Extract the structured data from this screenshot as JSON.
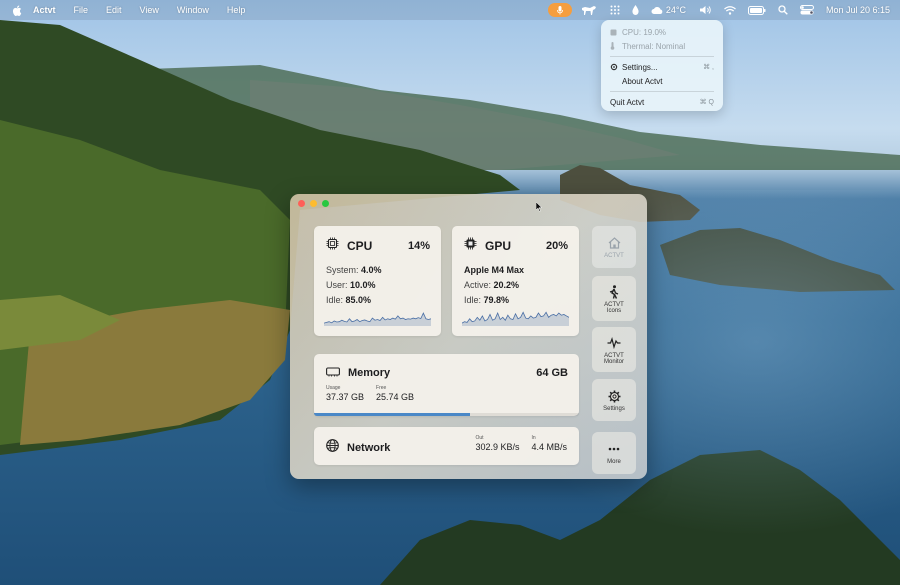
{
  "menubar": {
    "app_name": "Actvt",
    "menus": [
      "File",
      "Edit",
      "View",
      "Window",
      "Help"
    ],
    "weather": "24°C",
    "clock": "Mon Jul 20  6:15",
    "icons": [
      "apple-icon",
      "microphone-icon",
      "horse-icon",
      "grid-icon",
      "drop-icon",
      "cloud-icon",
      "volume-icon",
      "wifi-icon",
      "battery-icon",
      "search-icon",
      "control-center-icon"
    ]
  },
  "dropdown": {
    "cpu": "CPU: 19.0%",
    "thermal": "Thermal: Nominal",
    "settings": "Settings...",
    "settings_shortcut": "⌘ ,",
    "about": "About Actvt",
    "quit": "Quit Actvt",
    "quit_shortcut": "⌘ Q"
  },
  "cpu": {
    "title": "CPU",
    "percent": "14%",
    "system_label": "System:",
    "system_value": "4.0%",
    "user_label": "User:",
    "user_value": "10.0%",
    "idle_label": "Idle:",
    "idle_value": "85.0%",
    "history": [
      0.2,
      0.25,
      0.3,
      0.22,
      0.35,
      0.28,
      0.3,
      0.4,
      0.32,
      0.28,
      0.5,
      0.3,
      0.35,
      0.45,
      0.3,
      0.38,
      0.42,
      0.35,
      0.3,
      0.55,
      0.4,
      0.45,
      0.38,
      0.6,
      0.42,
      0.5,
      0.45,
      0.55,
      0.48,
      0.7,
      0.5,
      0.55,
      0.45,
      0.5,
      0.48,
      0.55,
      0.5,
      0.58,
      0.52,
      0.9,
      0.5,
      0.45,
      0.5
    ]
  },
  "gpu": {
    "title": "GPU",
    "percent": "20%",
    "model": "Apple M4 Max",
    "active_label": "Active:",
    "active_value": "20.2%",
    "idle_label": "Idle:",
    "idle_value": "79.8%",
    "history": [
      0.2,
      0.3,
      0.25,
      0.5,
      0.3,
      0.35,
      0.6,
      0.4,
      0.7,
      0.35,
      0.45,
      0.8,
      0.4,
      0.5,
      0.9,
      0.45,
      0.6,
      0.4,
      0.75,
      0.5,
      0.45,
      0.85,
      0.5,
      0.6,
      0.95,
      0.55,
      0.5,
      0.7,
      0.55,
      0.6,
      0.9,
      0.65,
      0.7,
      0.95,
      0.6,
      0.75,
      0.8,
      0.7,
      0.9,
      0.75,
      0.8,
      0.7,
      0.6
    ]
  },
  "memory": {
    "title": "Memory",
    "total": "64 GB",
    "usage_label": "Usage",
    "usage_value": "37.37 GB",
    "free_label": "Free",
    "free_value": "25.74 GB",
    "used_fraction": 0.59
  },
  "network": {
    "title": "Network",
    "out_label": "Out",
    "out_value": "302.9 KB/s",
    "in_label": "In",
    "in_value": "4.4 MB/s"
  },
  "sidebar": {
    "actvt": "ACTVT",
    "icons_line1": "ACTVT",
    "icons_line2": "Icons",
    "monitor_line1": "ACTVT",
    "monitor_line2": "Monitor",
    "settings": "Settings",
    "more": "More"
  },
  "colors": {
    "accent": "#4a88c7",
    "mic_pill": "#f59e3f"
  }
}
